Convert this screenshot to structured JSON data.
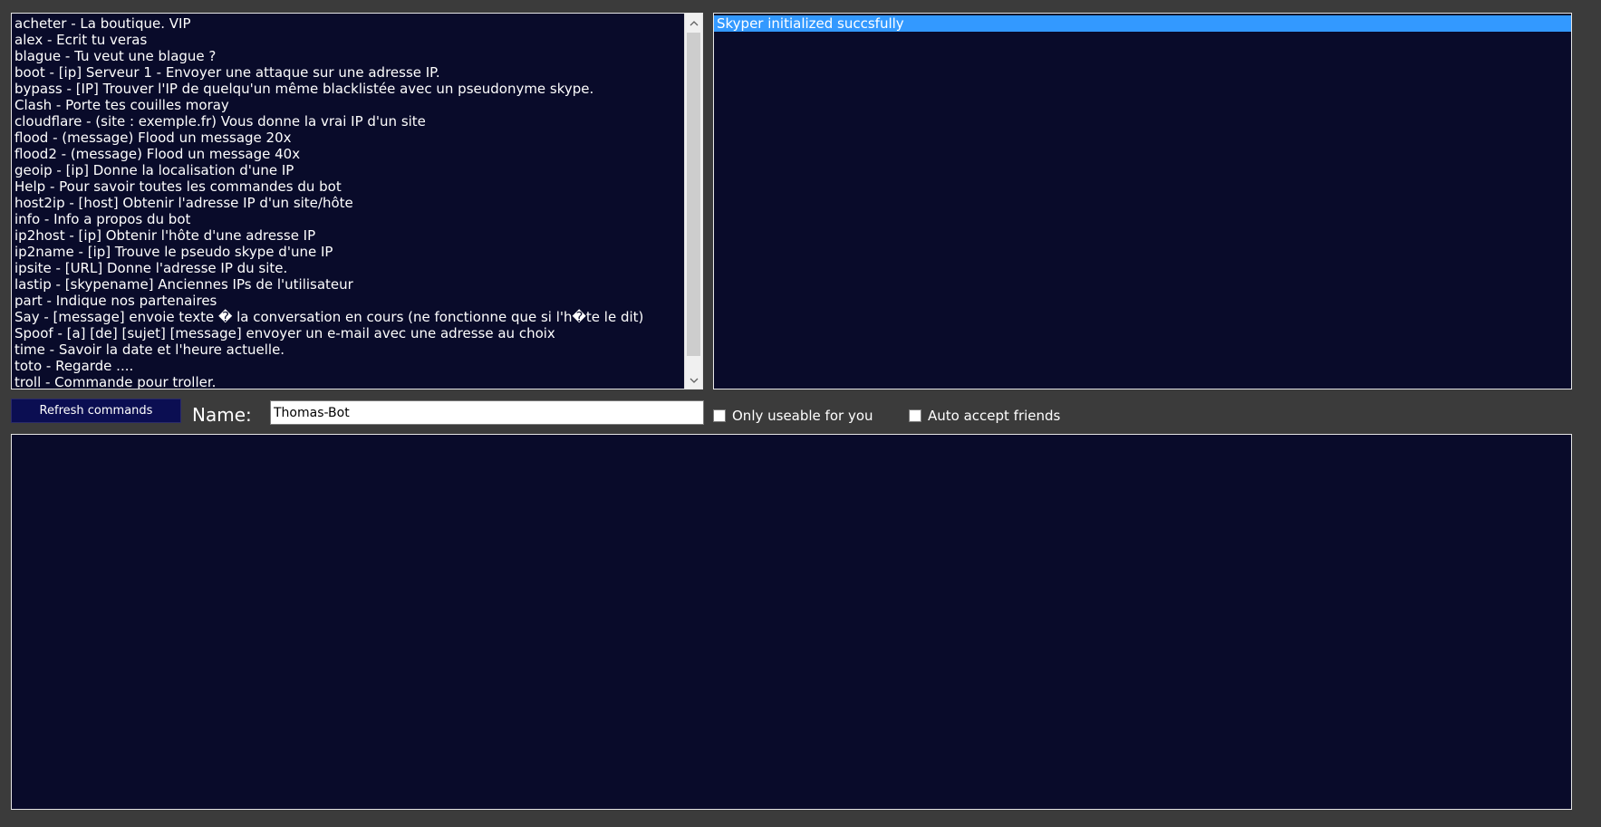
{
  "commands": [
    "acheter - La boutique. VIP",
    "alex - Ecrit tu veras",
    "blague - Tu veut une blague ?",
    "boot - [ip] Serveur 1 - Envoyer une attaque sur une adresse IP.",
    "bypass - [IP] Trouver l'IP de quelqu'un même blacklistée avec un pseudonyme skype.",
    "Clash - Porte tes couilles moray",
    "cloudflare - (site : exemple.fr) Vous donne la vrai IP d'un site",
    "flood - (message) Flood un message 20x",
    "flood2 - (message) Flood un message 40x",
    "geoip - [ip] Donne la localisation d'une IP",
    "Help - Pour savoir toutes les commandes du bot",
    "host2ip - [host] Obtenir l'adresse IP d'un site/hôte",
    "info - Info a propos du bot",
    "ip2host - [ip] Obtenir l'hôte d'une adresse IP",
    "ip2name - [ip] Trouve le pseudo skype d'une IP",
    "ipsite - [URL] Donne l'adresse IP du site.",
    "lastip - [skypename] Anciennes IPs de l'utilisateur",
    "part - Indique nos partenaires",
    "Say - [message] envoie texte � la conversation en cours (ne fonctionne que si l'h�te le dit)",
    "Spoof - [a] [de] [sujet] [message] envoyer un e-mail avec une adresse au choix",
    "time - Savoir la date et l'heure actuelle.",
    "toto - Regarde ....",
    "troll - Commande pour troller."
  ],
  "log": {
    "selected_line": "Skyper initialized succsfully"
  },
  "controls": {
    "refresh_label": "Refresh commands",
    "name_label": "Name:",
    "name_value": "Thomas-Bot",
    "only_useable_label": "Only useable for you",
    "only_useable_checked": false,
    "auto_accept_label": "Auto accept friends",
    "auto_accept_checked": false
  },
  "icons": {
    "scroll_up": "chevron-up-icon",
    "scroll_down": "chevron-down-icon"
  },
  "colors": {
    "window_bg": "#3b3b3b",
    "panel_bg": "#090b2a",
    "selection": "#3399ff",
    "button_bg": "#0b0e52"
  }
}
